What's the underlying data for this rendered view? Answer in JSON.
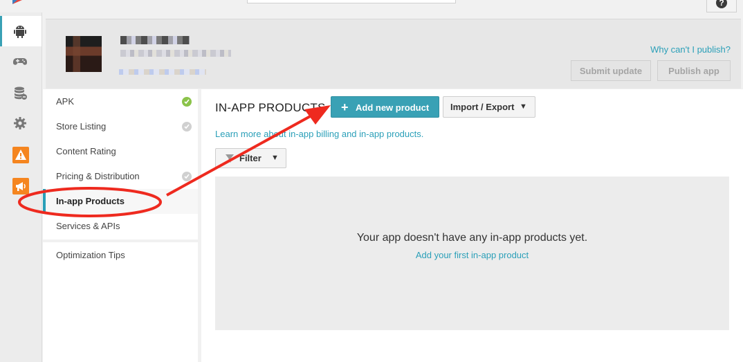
{
  "colors": {
    "accent": "#39a1b5",
    "link": "#2a9fb8",
    "check_ok": "#8bc34a",
    "annotation": "#ee2a1f"
  },
  "topbar": {
    "help_icon_glyph": "?"
  },
  "rail": {
    "items": [
      "android-icon",
      "gamepad-icon",
      "database-icon",
      "gear-icon",
      "warning-icon",
      "megaphone-icon"
    ]
  },
  "header": {
    "why_link": "Why can't I publish?",
    "submit_button": "Submit update",
    "publish_button": "Publish app"
  },
  "nav": {
    "items": [
      {
        "label": "APK",
        "status": "complete"
      },
      {
        "label": "Store Listing",
        "status": "done"
      },
      {
        "label": "Content Rating",
        "status": "none"
      },
      {
        "label": "Pricing & Distribution",
        "status": "done"
      },
      {
        "label": "In-app Products",
        "status": "selected"
      },
      {
        "label": "Services & APIs",
        "status": "none"
      }
    ],
    "optimization": "Optimization Tips"
  },
  "main": {
    "title": "IN-APP PRODUCTS",
    "add_button": "Add new product",
    "add_button_icon": "+",
    "import_button": "Import / Export",
    "caret": "▼",
    "learn_link": "Learn more about in-app billing and in-app products.",
    "filter_button": "Filter",
    "empty_message": "Your app doesn't have any in-app products yet.",
    "empty_link": "Add your first in-app product"
  }
}
